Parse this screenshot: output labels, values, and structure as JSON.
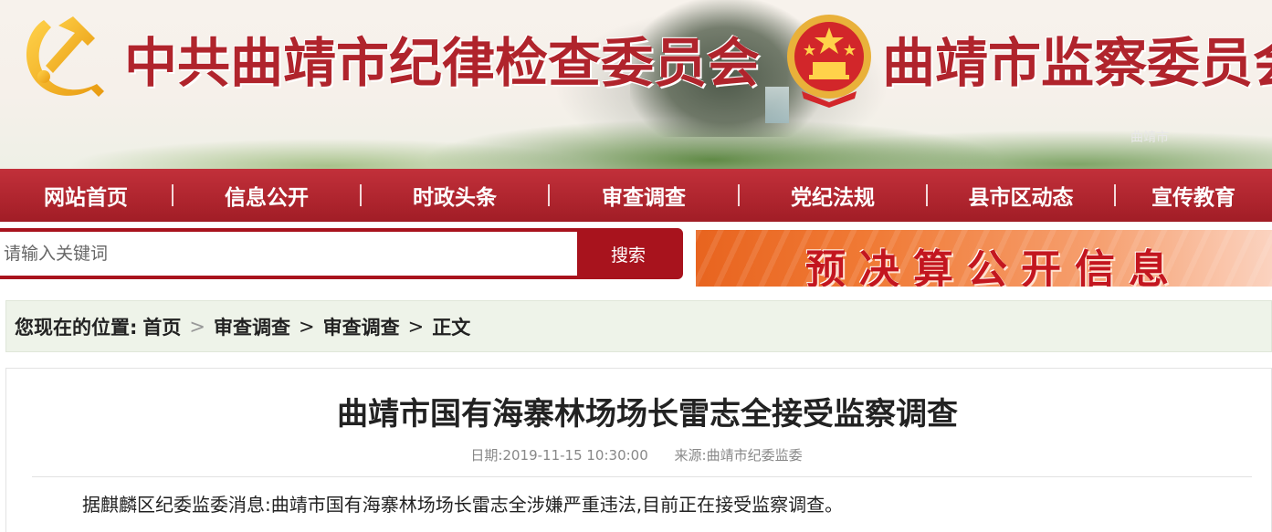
{
  "header": {
    "title_left": "中共曲靖市纪律检查委员会",
    "title_right": "曲靖市监察委员会",
    "watermark": "曲靖市"
  },
  "nav": {
    "items": [
      "网站首页",
      "信息公开",
      "时政头条",
      "审查调查",
      "党纪法规",
      "县市区动态",
      "宣传教育"
    ]
  },
  "search": {
    "placeholder": "请输入关键词",
    "button_label": "搜索"
  },
  "budget_banner": {
    "text": "预决算公开信息"
  },
  "breadcrumb": {
    "prefix": "您现在的位置:",
    "items": [
      "首页",
      "审查调查",
      "审查调查",
      "正文"
    ],
    "separator": ">"
  },
  "article": {
    "title": "曲靖市国有海寨林场场长雷志全接受监察调查",
    "date_label": "日期:2019-11-15 10:30:00",
    "source_label": "来源:曲靖市纪委监委",
    "body": "据麒麟区纪委监委消息:曲靖市国有海寨林场场长雷志全涉嫌严重违法,目前正在接受监察调查。"
  },
  "colors": {
    "brand_red": "#b0242c",
    "nav_red": "#a11d26",
    "breadcrumb_bg": "#eef3e9"
  }
}
